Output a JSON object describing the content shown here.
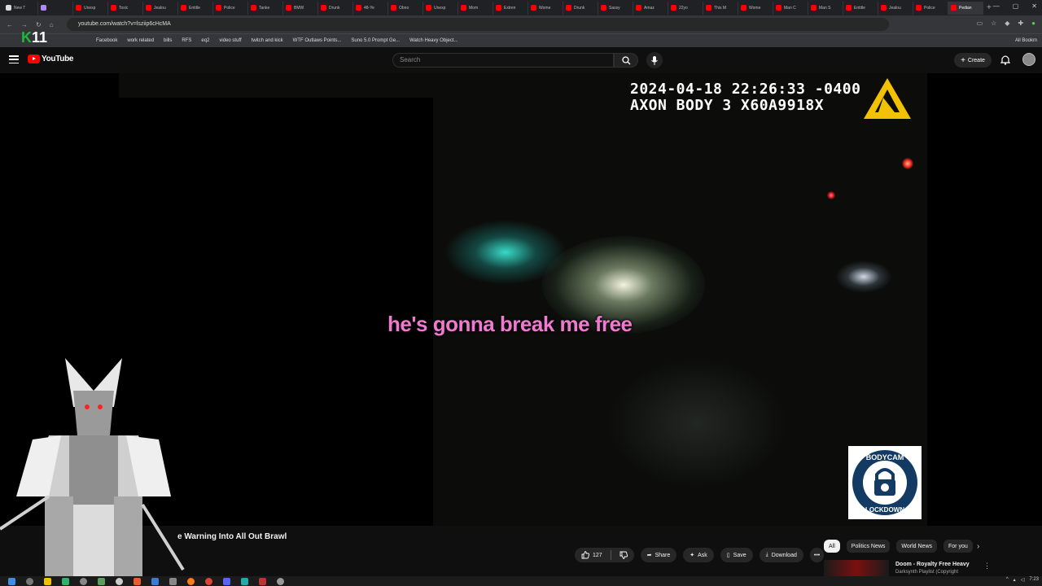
{
  "browser": {
    "tabs": [
      {
        "label": "New T"
      },
      {
        "label": ""
      },
      {
        "label": "Unexp"
      },
      {
        "label": "Toxic"
      },
      {
        "label": "Jealou"
      },
      {
        "label": "Entitle"
      },
      {
        "label": "Police"
      },
      {
        "label": "Tanke"
      },
      {
        "label": "BMW"
      },
      {
        "label": "Drunk"
      },
      {
        "label": "48-Ye"
      },
      {
        "label": "Obno"
      },
      {
        "label": "Unexp"
      },
      {
        "label": "Mom"
      },
      {
        "label": "Extren"
      },
      {
        "label": "Wome"
      },
      {
        "label": "Drunk"
      },
      {
        "label": "Sassy"
      },
      {
        "label": "Amaz"
      },
      {
        "label": "22yo"
      },
      {
        "label": "This M"
      },
      {
        "label": "Wome"
      },
      {
        "label": "Man C"
      },
      {
        "label": "Man S"
      },
      {
        "label": "Entitle"
      },
      {
        "label": "Jealou"
      },
      {
        "label": "Police"
      },
      {
        "label": "Pedian"
      }
    ],
    "url": "youtube.com/watch?v=lsziip6cHcMA",
    "bookmarks": [
      "Facebook",
      "work related",
      "bills",
      "RFS",
      "eq2",
      "video stuff",
      "twitch and kick",
      "WTF Outlaws Points...",
      "Suno 5.0 Prompt Ge...",
      "Watch Heavy Object..."
    ],
    "all_bookmarks": "All Bookm"
  },
  "overlay": {
    "k11_prefix": "K",
    "k11_num": "11"
  },
  "youtube": {
    "logo_text": "YouTube",
    "search_placeholder": "Search",
    "create_label": "Create"
  },
  "video": {
    "timestamp_line1": "2024-04-18 22:26:33 -0400",
    "timestamp_line2": "AXON BODY 3 X60A9918X",
    "caption": "he's gonna break me free",
    "badge_text": "BODYCAM LOCKDOWN"
  },
  "below_video": {
    "title": "e Warning Into All Out Brawl",
    "like_count": "127",
    "share_label": "Share",
    "ask_label": "Ask",
    "save_label": "Save",
    "download_label": "Download",
    "more_label": "•••"
  },
  "chips": [
    "All",
    "Politics News",
    "World News",
    "For you"
  ],
  "recommendation": {
    "title": "Doom - Royalty Free Heavy",
    "subtitle": "Darksynth Playlist (Copyright"
  },
  "taskbar": {
    "clock": "7:23"
  }
}
